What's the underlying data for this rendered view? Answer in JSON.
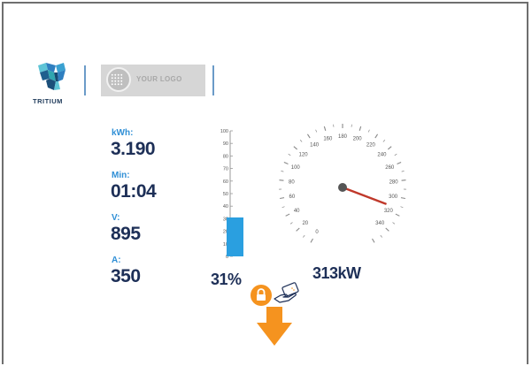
{
  "brand": {
    "name": "TRITIUM",
    "placeholder_logo_text": "YOUR LOGO"
  },
  "stats": [
    {
      "label": "kWh:",
      "value": "3.190"
    },
    {
      "label": "Min:",
      "value": "01:04"
    },
    {
      "label": "V:",
      "value": "895"
    },
    {
      "label": "A:",
      "value": "350"
    }
  ],
  "charge_bar": {
    "scale_labels": [
      "100",
      "90",
      "80",
      "70",
      "60",
      "50",
      "40",
      "30",
      "20",
      "10",
      "0"
    ],
    "level_percent": 31,
    "percent_text": "31%"
  },
  "speedometer": {
    "scale_labels": [
      "0",
      "20",
      "40",
      "60",
      "80",
      "100",
      "120",
      "140",
      "160",
      "180",
      "200",
      "220",
      "240",
      "260",
      "280",
      "300",
      "320",
      "340"
    ],
    "needle_value_kw": 313,
    "power_text": "313kW"
  },
  "status_icons": [
    "lock-icon",
    "charging-card-icon",
    "down-arrow-icon"
  ],
  "colors": {
    "navy": "#1d2f57",
    "label_blue": "#2f8fd6",
    "bar_blue": "#2a9fe0",
    "needle_red": "#c0392b",
    "orange": "#f5931f",
    "logo_teal": "#2fa6b0"
  }
}
